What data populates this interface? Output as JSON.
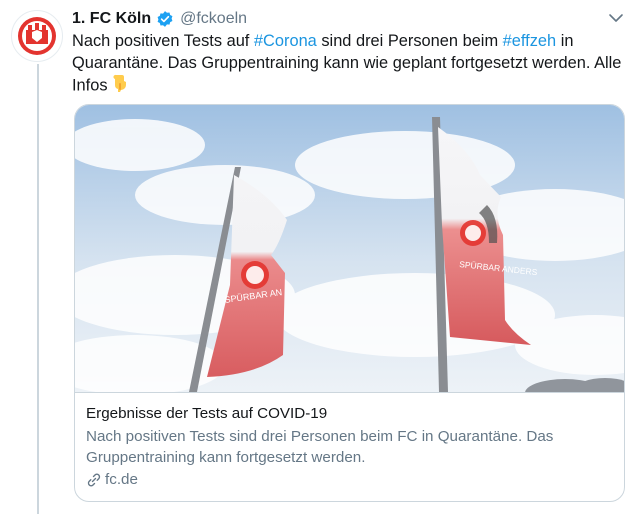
{
  "tweet": {
    "author_name": "1. FC Köln",
    "author_handle": "@fckoeln",
    "text_parts": {
      "p1": "Nach positiven Tests auf ",
      "h1": "#Corona",
      "p2": " sind drei Personen beim ",
      "h2": "#effzeh",
      "p3": " in Quarantäne. Das Gruppentraining kann wie geplant fortgesetzt werden. Alle Infos"
    },
    "emoji": "pointing-down-emoji"
  },
  "card": {
    "title": "Ergebnisse der Tests auf COVID-19",
    "description": "Nach positiven Tests sind drei Personen beim FC in Quarantäne. Das Gruppentraining kann fortgesetzt werden.",
    "domain": "fc.de",
    "flag_text_left": "SPÜRBAR AN",
    "flag_text_right": "SPÜRBAR ANDERS"
  },
  "colors": {
    "hashtag": "#1b95e0",
    "verified": "#1da1f2",
    "club_red": "#e3342f",
    "muted": "#657786"
  },
  "icons": [
    "club-logo",
    "verified-badge-icon",
    "chevron-down-icon",
    "link-icon"
  ]
}
